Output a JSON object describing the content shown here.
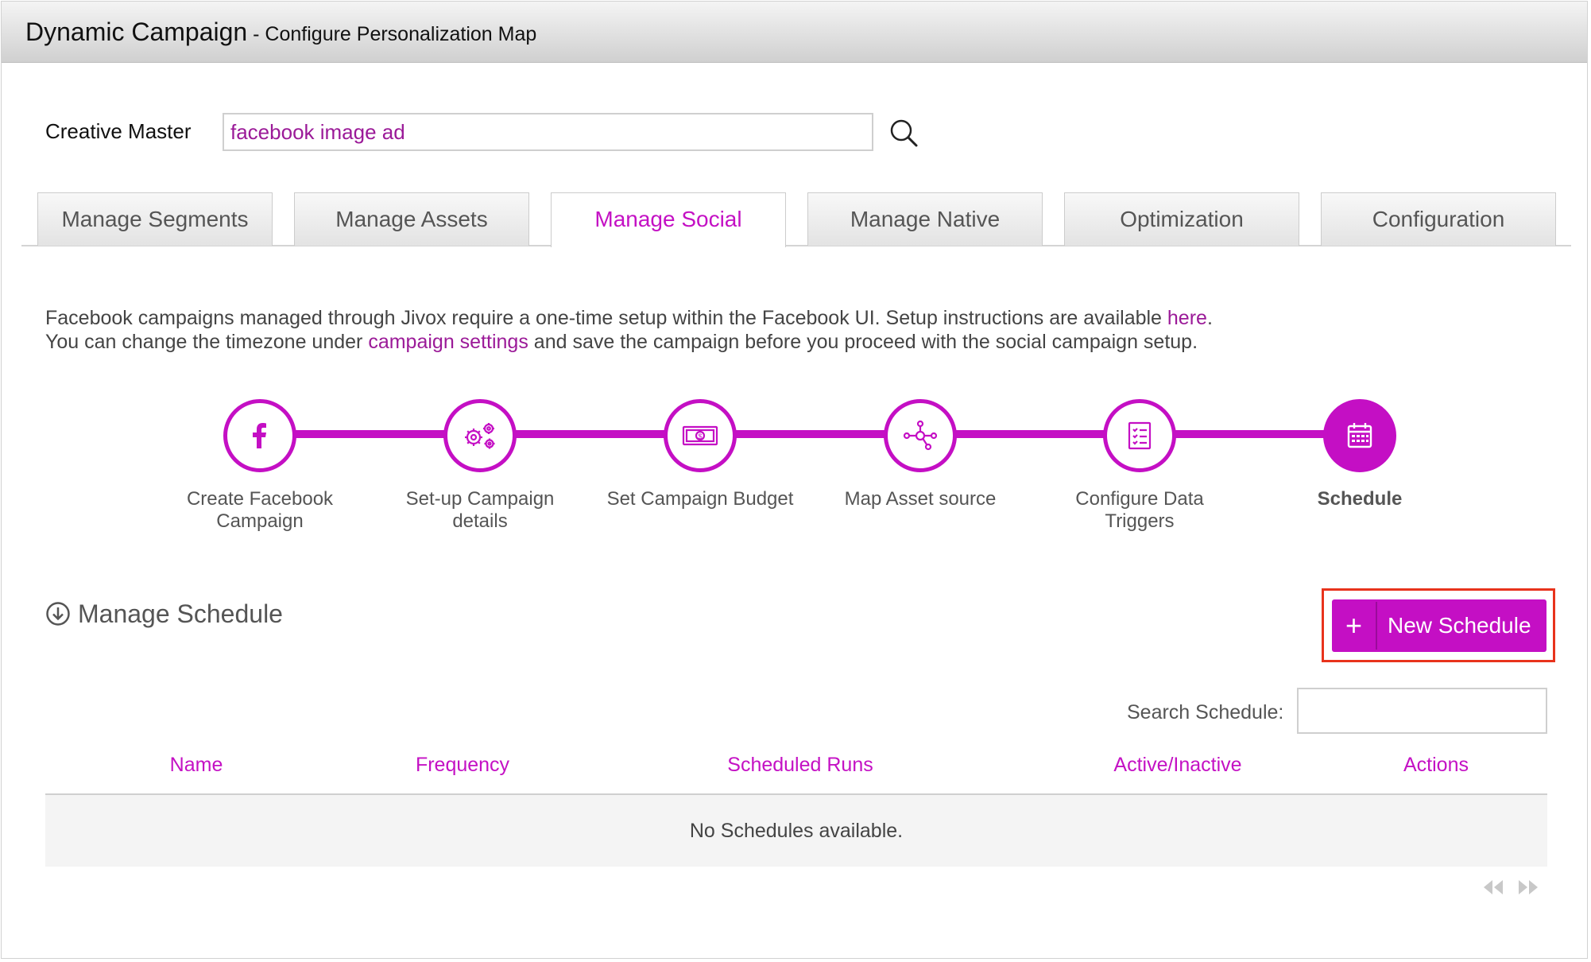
{
  "header": {
    "app_title": "Dynamic Campaign",
    "subtitle": " - Configure Personalization Map"
  },
  "creative_master": {
    "label": "Creative Master",
    "value": "facebook image ad",
    "search_icon": "search-icon"
  },
  "tabs": [
    {
      "label": "Manage Segments",
      "active": false
    },
    {
      "label": "Manage Assets",
      "active": false
    },
    {
      "label": "Manage Social",
      "active": true
    },
    {
      "label": "Manage Native",
      "active": false
    },
    {
      "label": "Optimization",
      "active": false
    },
    {
      "label": "Configuration",
      "active": false
    }
  ],
  "info": {
    "line1_text": "Facebook campaigns managed through Jivox require a one-time setup within the Facebook UI. Setup instructions are available ",
    "line1_link": "here",
    "line1_end": ".",
    "line2_pre": "You can change the timezone under ",
    "line2_link": "campaign settings",
    "line2_post": " and save the campaign before you proceed with the social campaign setup."
  },
  "steps": [
    {
      "label": "Create Facebook Campaign",
      "icon": "facebook-icon",
      "current": false
    },
    {
      "label": "Set-up Campaign details",
      "icon": "gears-icon",
      "current": false
    },
    {
      "label": "Set Campaign Budget",
      "icon": "money-icon",
      "current": false
    },
    {
      "label": "Map Asset source",
      "icon": "network-icon",
      "current": false
    },
    {
      "label": "Configure Data Triggers",
      "icon": "checklist-icon",
      "current": false
    },
    {
      "label": "Schedule",
      "icon": "calendar-icon",
      "current": true
    }
  ],
  "schedule": {
    "title": "Manage Schedule",
    "new_button_plus": "+",
    "new_button_label": "New Schedule",
    "search_label": "Search Schedule:",
    "search_value": "",
    "columns": [
      "Name",
      "Frequency",
      "Scheduled Runs",
      "Active/Inactive",
      "Actions"
    ],
    "empty_message": "No Schedules available."
  },
  "colors": {
    "accent": "#c40fc4",
    "link": "#9b1a98",
    "highlight": "#e8331c"
  }
}
